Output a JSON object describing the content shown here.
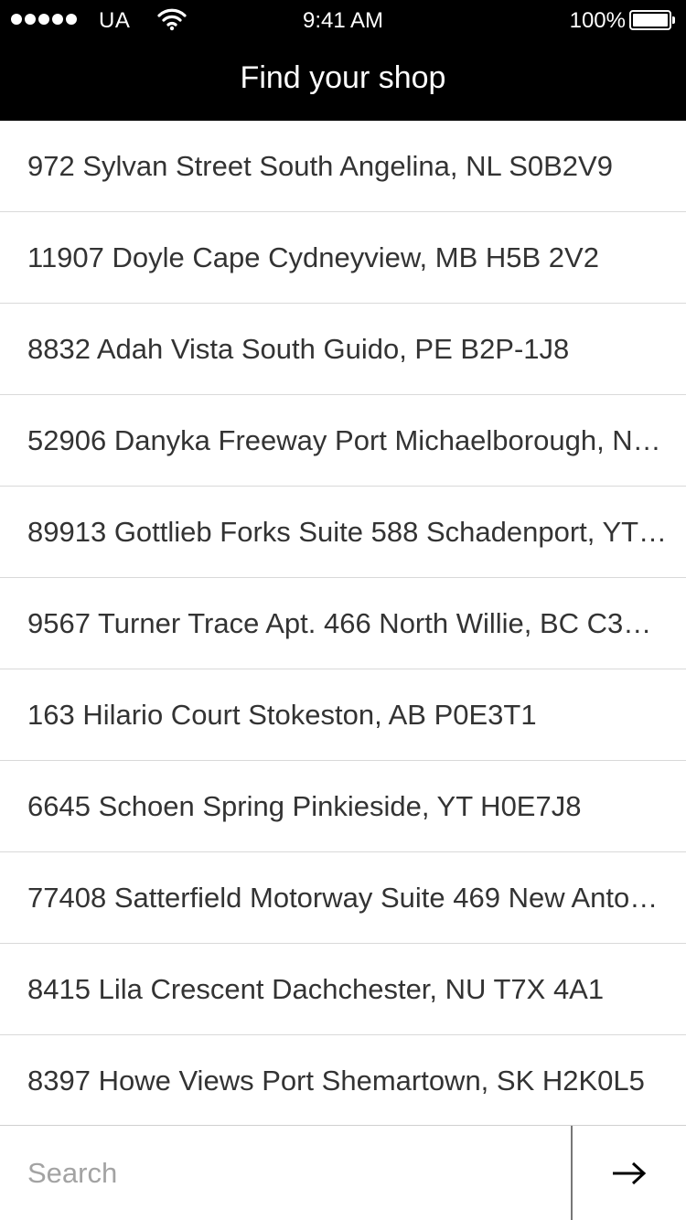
{
  "status_bar": {
    "carrier": "UA",
    "time": "9:41 AM",
    "battery": "100%"
  },
  "nav": {
    "title": "Find your shop"
  },
  "addresses": [
    "972 Sylvan Street South Angelina, NL S0B2V9",
    "11907 Doyle Cape Cydneyview, MB H5B 2V2",
    "8832 Adah Vista South Guido, PE B2P-1J8",
    "52906 Danyka Freeway Port Michaelborough, N…",
    "89913 Gottlieb Forks Suite 588 Schadenport, YT…",
    "9567 Turner Trace Apt. 466 North Willie, BC C3…",
    "163 Hilario Court Stokeston, AB P0E3T1",
    "6645 Schoen Spring Pinkieside, YT H0E7J8",
    "77408 Satterfield Motorway Suite 469 New Anto…",
    "8415 Lila Crescent Dachchester, NU T7X 4A1",
    "8397 Howe Views Port Shemartown, SK H2K0L5"
  ],
  "search": {
    "placeholder": "Search",
    "value": ""
  },
  "icons": {
    "signal": "signal-strength-icon",
    "wifi": "wifi-icon",
    "battery": "battery-icon",
    "go": "arrow-right-icon"
  },
  "colors": {
    "header_background": "#000000",
    "header_text": "#ffffff",
    "row_text": "#333333",
    "divider": "#d9d9d9",
    "placeholder": "#a3a3a3"
  }
}
